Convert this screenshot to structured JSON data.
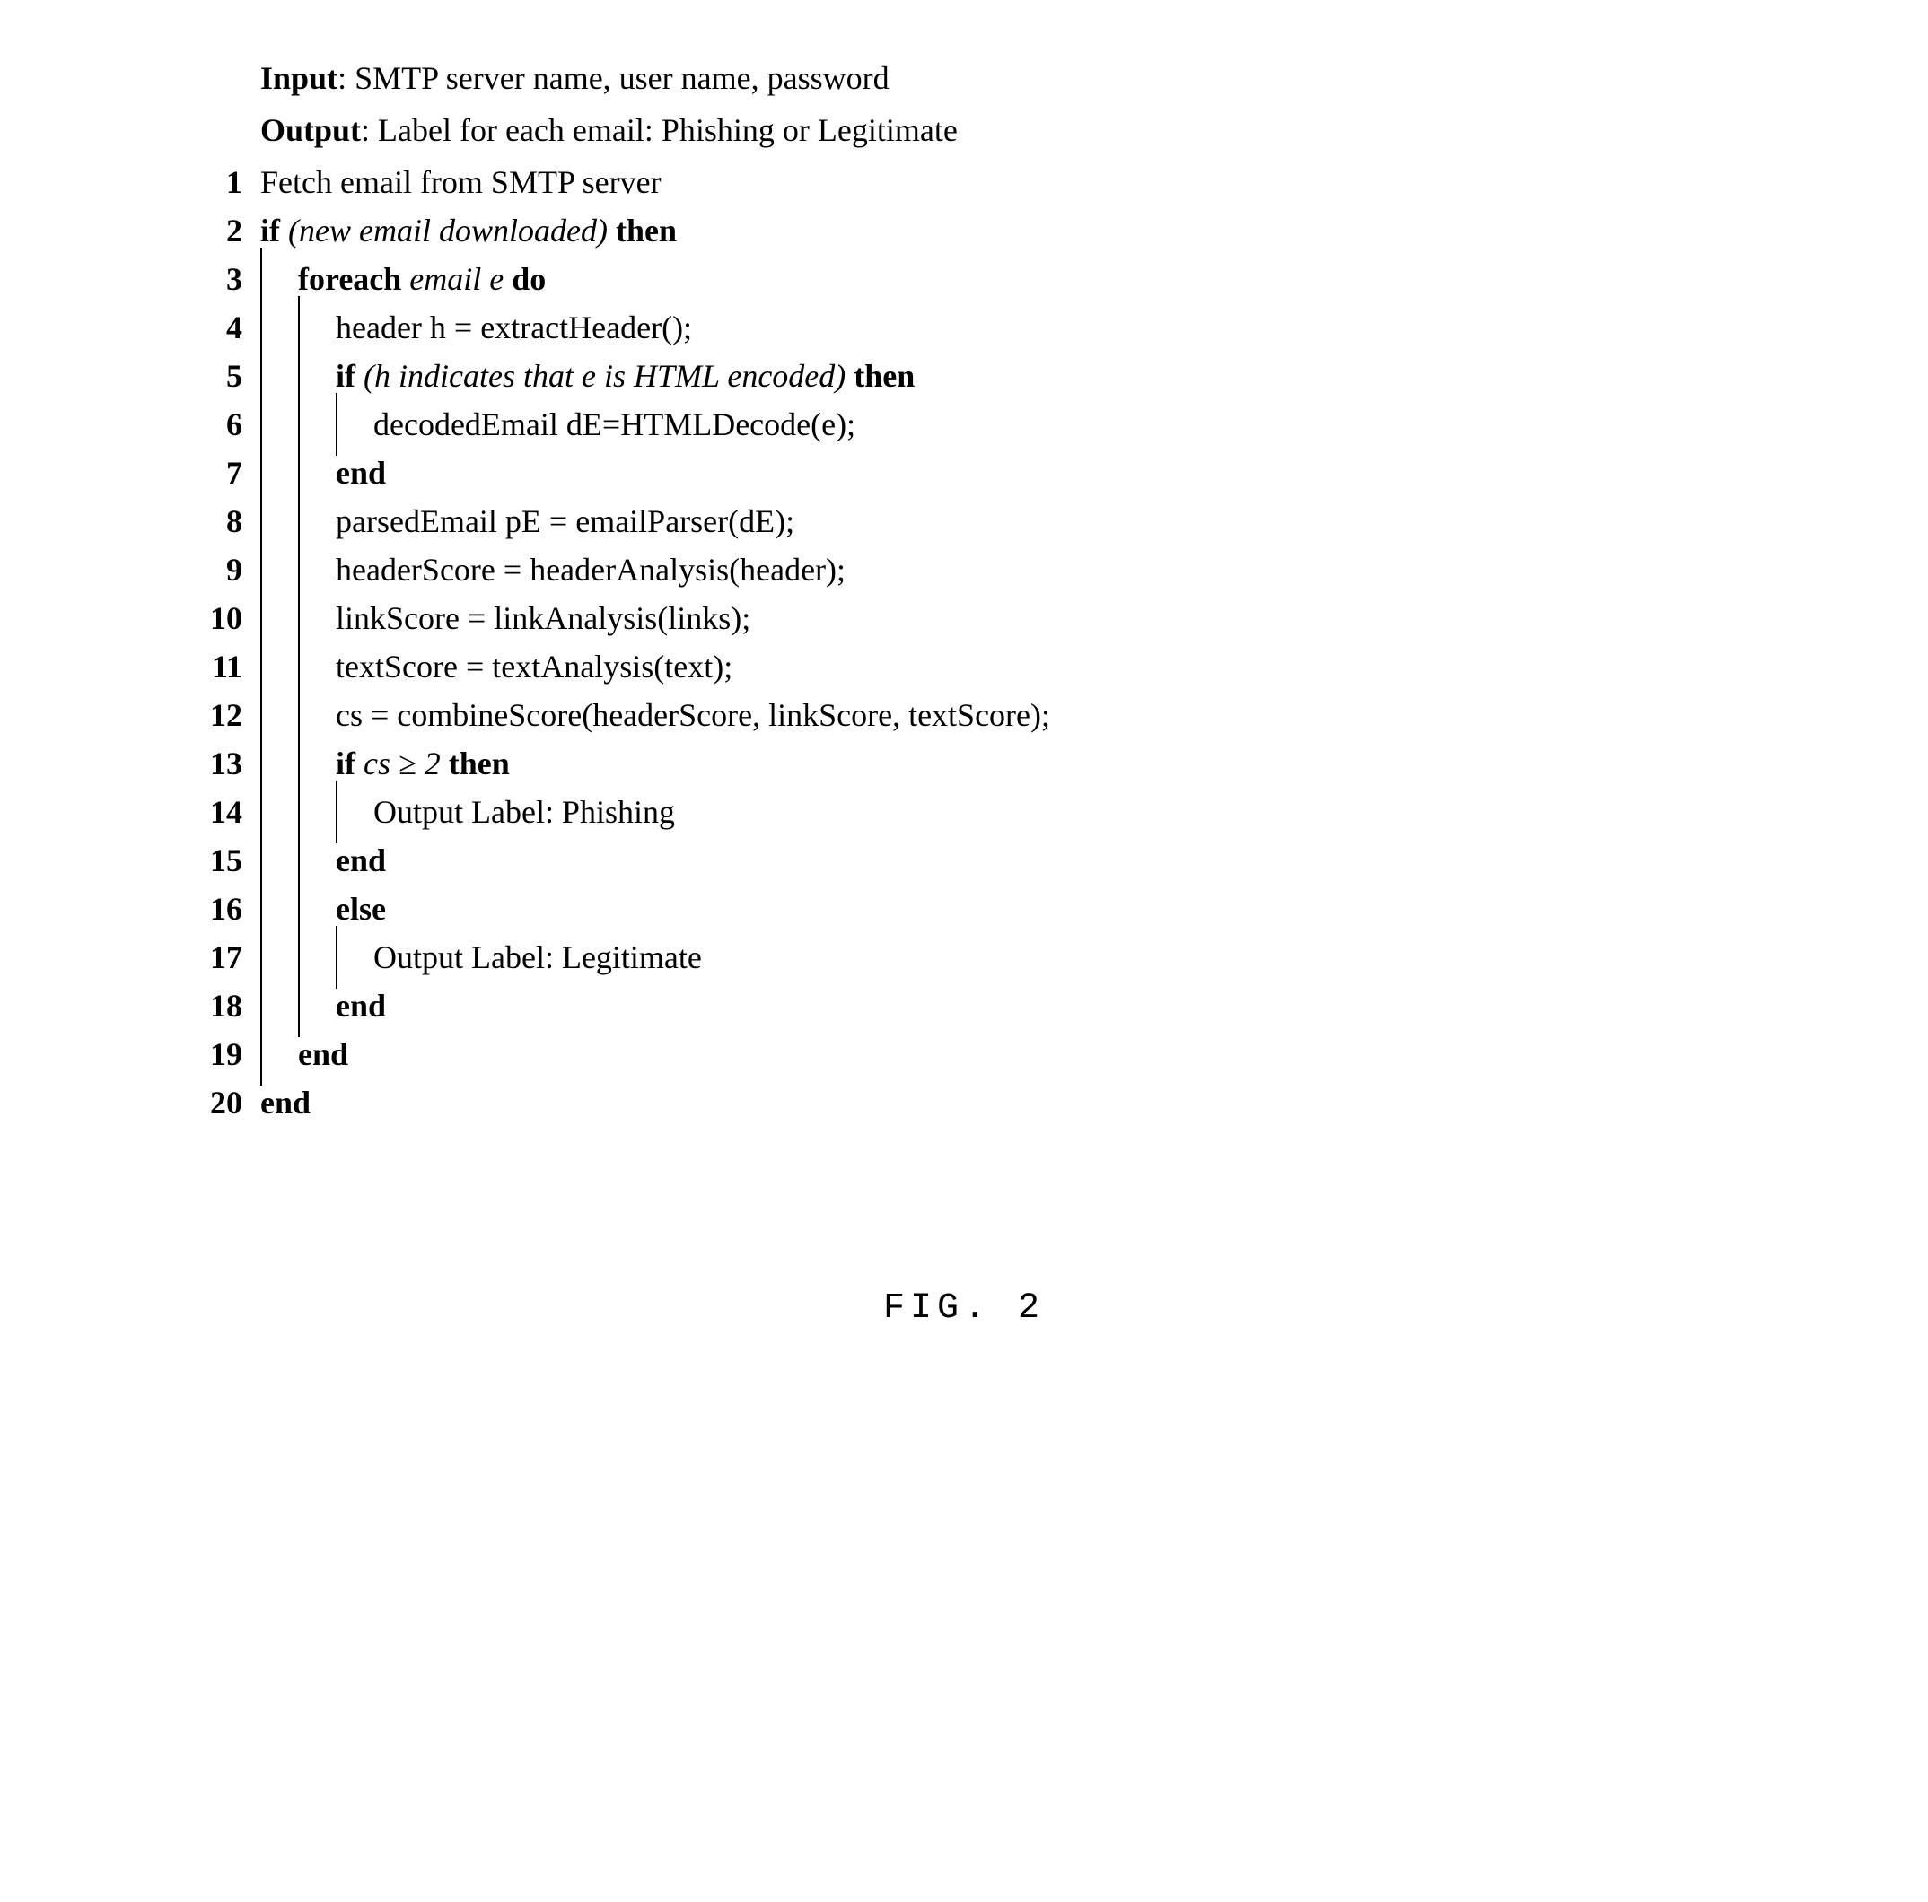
{
  "preamble": {
    "input_label": "Input",
    "input_text": ": SMTP server name, user name, password",
    "output_label": "Output",
    "output_text": ": Label for each email: Phishing or Legitimate"
  },
  "lines": [
    {
      "num": "1",
      "rules": 0,
      "parts": [
        {
          "t": "Fetch email from SMTP server"
        }
      ]
    },
    {
      "num": "2",
      "rules": 0,
      "parts": [
        {
          "t": "if ",
          "b": true
        },
        {
          "t": "(new email downloaded)",
          "i": true
        },
        {
          "t": " then",
          "b": true
        }
      ]
    },
    {
      "num": "3",
      "rules": 1,
      "indent": 1,
      "parts": [
        {
          "t": "foreach ",
          "b": true
        },
        {
          "t": "email e",
          "i": true
        },
        {
          "t": " do",
          "b": true
        }
      ]
    },
    {
      "num": "4",
      "rules": 2,
      "indent": 2,
      "parts": [
        {
          "t": "header h = extractHeader();"
        }
      ]
    },
    {
      "num": "5",
      "rules": 2,
      "indent": 2,
      "parts": [
        {
          "t": "if ",
          "b": true
        },
        {
          "t": "(h indicates that e is HTML encoded)",
          "i": true
        },
        {
          "t": " then",
          "b": true
        }
      ]
    },
    {
      "num": "6",
      "rules": 3,
      "indent": 3,
      "parts": [
        {
          "t": "decodedEmail dE=HTMLDecode(e);"
        }
      ]
    },
    {
      "num": "7",
      "rules": 2,
      "indent": 2,
      "parts": [
        {
          "t": "end",
          "b": true
        }
      ]
    },
    {
      "num": "8",
      "rules": 2,
      "indent": 2,
      "parts": [
        {
          "t": "parsedEmail pE = emailParser(dE);"
        }
      ]
    },
    {
      "num": "9",
      "rules": 2,
      "indent": 2,
      "parts": [
        {
          "t": "headerScore = headerAnalysis(header);"
        }
      ]
    },
    {
      "num": "10",
      "rules": 2,
      "indent": 2,
      "parts": [
        {
          "t": "linkScore = linkAnalysis(links);"
        }
      ]
    },
    {
      "num": "11",
      "rules": 2,
      "indent": 2,
      "parts": [
        {
          "t": "textScore = textAnalysis(text);"
        }
      ]
    },
    {
      "num": "12",
      "rules": 2,
      "indent": 2,
      "parts": [
        {
          "t": "cs = combineScore(headerScore, linkScore, textScore);"
        }
      ]
    },
    {
      "num": "13",
      "rules": 2,
      "indent": 2,
      "parts": [
        {
          "t": "if ",
          "b": true
        },
        {
          "t": "cs ≥ 2",
          "i": true
        },
        {
          "t": " then",
          "b": true
        }
      ]
    },
    {
      "num": "14",
      "rules": 3,
      "indent": 3,
      "parts": [
        {
          "t": "Output Label: Phishing"
        }
      ]
    },
    {
      "num": "15",
      "rules": 2,
      "indent": 2,
      "parts": [
        {
          "t": "end",
          "b": true
        }
      ]
    },
    {
      "num": "16",
      "rules": 2,
      "indent": 2,
      "parts": [
        {
          "t": "else",
          "b": true
        }
      ]
    },
    {
      "num": "17",
      "rules": 3,
      "indent": 3,
      "parts": [
        {
          "t": "Output Label: Legitimate"
        }
      ]
    },
    {
      "num": "18",
      "rules": 2,
      "indent": 2,
      "parts": [
        {
          "t": "end",
          "b": true
        }
      ]
    },
    {
      "num": "19",
      "rules": 1,
      "indent": 1,
      "parts": [
        {
          "t": "end",
          "b": true
        }
      ]
    },
    {
      "num": "20",
      "rules": 0,
      "indent": 0,
      "parts": [
        {
          "t": "end",
          "b": true
        }
      ]
    }
  ],
  "caption": "FIG. 2"
}
